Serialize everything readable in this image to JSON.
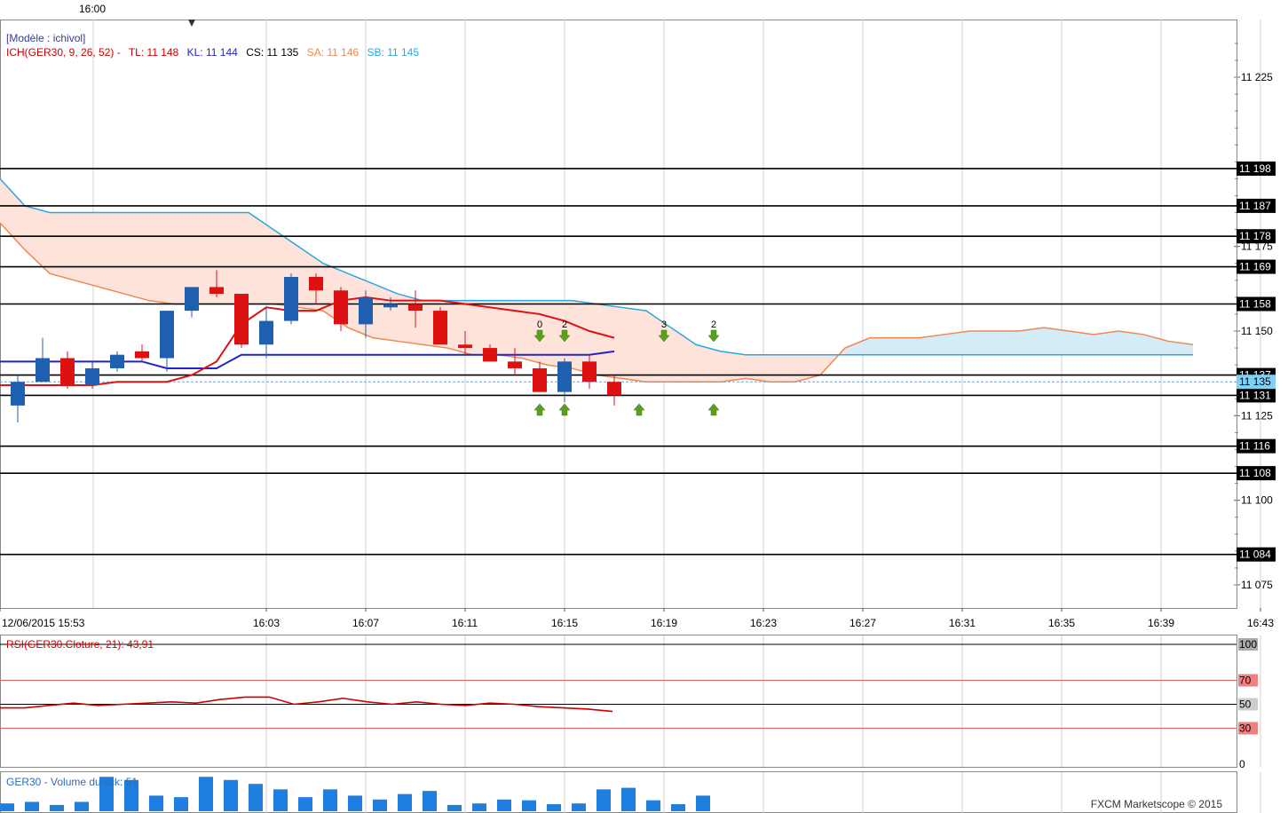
{
  "top_marker_label": "16:00",
  "legends": {
    "model": "[Modèle : ichivol]",
    "ich_name": "ICH(GER30, 9, 26, 52) -",
    "tl": "TL: 11 148",
    "kl": "KL: 11 144",
    "cs": "CS: 11 135",
    "sa": "SA: 11 146",
    "sb": "SB: 11 145",
    "rsi": "RSI(GER30.Cloture, 21): 43,91",
    "volume": "GER30 - Volume du tick: 51"
  },
  "brand": "FXCM Marketscope © 2015",
  "colors": {
    "up": "#1f5fb0",
    "down": "#dd1111",
    "tenkan": "#dd1111",
    "kijun": "#2222cc",
    "senkou_a": "#f08850",
    "senkou_b": "#29a8e0",
    "cloud_bear": "#fde3da",
    "cloud_bull": "#d4ecf8",
    "rsi": "#cc0000",
    "volume": "#1e7fe0",
    "arrow": "#5aa01e"
  },
  "chart_data": [
    {
      "type": "candlestick",
      "instrument": "GER30",
      "x_tick_labels": [
        "12/06/2015 15:53",
        "16:03",
        "16:07",
        "16:11",
        "16:15",
        "16:19",
        "16:23",
        "16:27",
        "16:31",
        "16:35",
        "16:39",
        "16:43"
      ],
      "y_tick_labels": [
        "11 225",
        "11 175",
        "11 150",
        "11 125",
        "11 100",
        "11 075"
      ],
      "y_ticks": [
        11225,
        11175,
        11150,
        11125,
        11100,
        11075
      ],
      "ylim": [
        11068,
        11240
      ],
      "horizontal_levels": [
        11198,
        11187,
        11178,
        11169,
        11158,
        11137,
        11131,
        11116,
        11108,
        11084
      ],
      "level_labels": [
        "11 198",
        "11 187",
        "11 178",
        "11 169",
        "11 158",
        "11 137",
        "11 131",
        "11 116",
        "11 108",
        "11 084"
      ],
      "current_price": 11135,
      "current_price_label": "11 135",
      "candles": [
        {
          "t": "15:53",
          "o": 11128,
          "h": 11137,
          "l": 11123,
          "c": 11135
        },
        {
          "t": "15:54",
          "o": 11135,
          "h": 11148,
          "l": 11135,
          "c": 11142
        },
        {
          "t": "15:55",
          "o": 11142,
          "h": 11144,
          "l": 11133,
          "c": 11134
        },
        {
          "t": "15:56",
          "o": 11134,
          "h": 11141,
          "l": 11133,
          "c": 11139
        },
        {
          "t": "15:57",
          "o": 11139,
          "h": 11144,
          "l": 11138,
          "c": 11143
        },
        {
          "t": "15:58",
          "o": 11144,
          "h": 11146,
          "l": 11141,
          "c": 11142
        },
        {
          "t": "15:59",
          "o": 11142,
          "h": 11156,
          "l": 11138,
          "c": 11156
        },
        {
          "t": "16:00",
          "o": 11156,
          "h": 11163,
          "l": 11154,
          "c": 11163
        },
        {
          "t": "16:01",
          "o": 11163,
          "h": 11168,
          "l": 11160,
          "c": 11161
        },
        {
          "t": "16:02",
          "o": 11161,
          "h": 11161,
          "l": 11145,
          "c": 11146
        },
        {
          "t": "16:03",
          "o": 11146,
          "h": 11157,
          "l": 11142,
          "c": 11153
        },
        {
          "t": "16:04",
          "o": 11153,
          "h": 11167,
          "l": 11152,
          "c": 11166
        },
        {
          "t": "16:05",
          "o": 11166,
          "h": 11167,
          "l": 11158,
          "c": 11162
        },
        {
          "t": "16:06",
          "o": 11162,
          "h": 11163,
          "l": 11150,
          "c": 11152
        },
        {
          "t": "16:07",
          "o": 11152,
          "h": 11162,
          "l": 11148,
          "c": 11160
        },
        {
          "t": "16:08",
          "o": 11157,
          "h": 11160,
          "l": 11156,
          "c": 11158
        },
        {
          "t": "16:09",
          "o": 11158,
          "h": 11162,
          "l": 11151,
          "c": 11156
        },
        {
          "t": "16:10",
          "o": 11156,
          "h": 11157,
          "l": 11146,
          "c": 11146
        },
        {
          "t": "16:11",
          "o": 11146,
          "h": 11150,
          "l": 11143,
          "c": 11145
        },
        {
          "t": "16:12",
          "o": 11145,
          "h": 11146,
          "l": 11141,
          "c": 11141
        },
        {
          "t": "16:13",
          "o": 11141,
          "h": 11145,
          "l": 11137,
          "c": 11139
        },
        {
          "t": "16:14",
          "o": 11139,
          "h": 11141,
          "l": 11132,
          "c": 11132
        },
        {
          "t": "16:15",
          "o": 11132,
          "h": 11142,
          "l": 11129,
          "c": 11141
        },
        {
          "t": "16:16",
          "o": 11141,
          "h": 11143,
          "l": 11133,
          "c": 11135
        },
        {
          "t": "16:17",
          "o": 11135,
          "h": 11137,
          "l": 11128,
          "c": 11131
        }
      ],
      "ichimoku": {
        "tenkan_label": "TL",
        "kijun_label": "KL",
        "chikou_label": "CS",
        "senkou_a_label": "SA",
        "senkou_b_label": "SB",
        "tenkan": [
          11134,
          11134,
          11134,
          11134,
          11135,
          11135,
          11135,
          11137,
          11141,
          11152,
          11157,
          11156,
          11156,
          11159,
          11160,
          11159,
          11159,
          11159,
          11158,
          11157,
          11156,
          11155,
          11153,
          11150,
          11148
        ],
        "kijun": [
          11141,
          11141,
          11141,
          11141,
          11141,
          11141,
          11139,
          11139,
          11139,
          11143,
          11143,
          11143,
          11143,
          11143,
          11143,
          11143,
          11143,
          11143,
          11143,
          11143,
          11143,
          11143,
          11143,
          11143,
          11144
        ],
        "senkou_a": [
          11182,
          11174,
          11167,
          11165,
          11163,
          11161,
          11159,
          11158,
          11158,
          11158,
          11158,
          11158,
          11157,
          11156,
          11151,
          11148,
          11147,
          11146,
          11145,
          11143,
          11143,
          11142,
          11140,
          11139,
          11137,
          11136,
          11135,
          11135,
          11135,
          11135,
          11136,
          11135,
          11135,
          11137,
          11145,
          11148,
          11148,
          11148,
          11149,
          11150,
          11150,
          11150,
          11151,
          11150,
          11149,
          11150,
          11149,
          11147,
          11146
        ],
        "senkou_b": [
          11195,
          11187,
          11185,
          11185,
          11185,
          11185,
          11185,
          11185,
          11185,
          11185,
          11185,
          11180,
          11175,
          11170,
          11167,
          11164,
          11161,
          11159,
          11159,
          11159,
          11159,
          11159,
          11159,
          11159,
          11158,
          11157,
          11156,
          11151,
          11146,
          11144,
          11143,
          11143,
          11143,
          11143,
          11143,
          11143,
          11143,
          11143,
          11143,
          11143,
          11143,
          11143,
          11143,
          11143,
          11143,
          11143,
          11143,
          11143,
          11143
        ]
      },
      "signals": [
        {
          "t": "16:14",
          "side": "down",
          "label": "0"
        },
        {
          "t": "16:14",
          "side": "up",
          "label": ""
        },
        {
          "t": "16:15",
          "side": "down",
          "label": "2"
        },
        {
          "t": "16:15",
          "side": "up",
          "label": ""
        },
        {
          "t": "16:18",
          "side": "up",
          "label": ""
        },
        {
          "t": "16:19",
          "side": "down",
          "label": "3"
        },
        {
          "t": "16:21",
          "side": "down",
          "label": "2"
        },
        {
          "t": "16:21",
          "side": "up",
          "label": ""
        }
      ]
    },
    {
      "type": "line",
      "name": "RSI(GER30.Cloture, 21)",
      "ylim": [
        0,
        100
      ],
      "y_tick_labels": [
        "100",
        "70",
        "50",
        "30",
        "0"
      ],
      "y_ticks": [
        100,
        70,
        50,
        30,
        0
      ],
      "values": [
        47,
        47,
        49,
        51,
        49,
        50,
        51,
        52,
        51,
        54,
        56,
        56,
        50,
        52,
        55,
        52,
        50,
        52,
        50,
        49,
        51,
        50,
        48,
        47,
        46,
        44
      ]
    },
    {
      "type": "bar",
      "name": "GER30 - Volume du tick",
      "values": [
        10,
        12,
        8,
        12,
        44,
        40,
        20,
        18,
        44,
        40,
        35,
        28,
        18,
        28,
        20,
        15,
        22,
        26,
        8,
        10,
        15,
        14,
        9,
        10,
        28,
        30,
        14,
        9,
        20
      ]
    }
  ]
}
